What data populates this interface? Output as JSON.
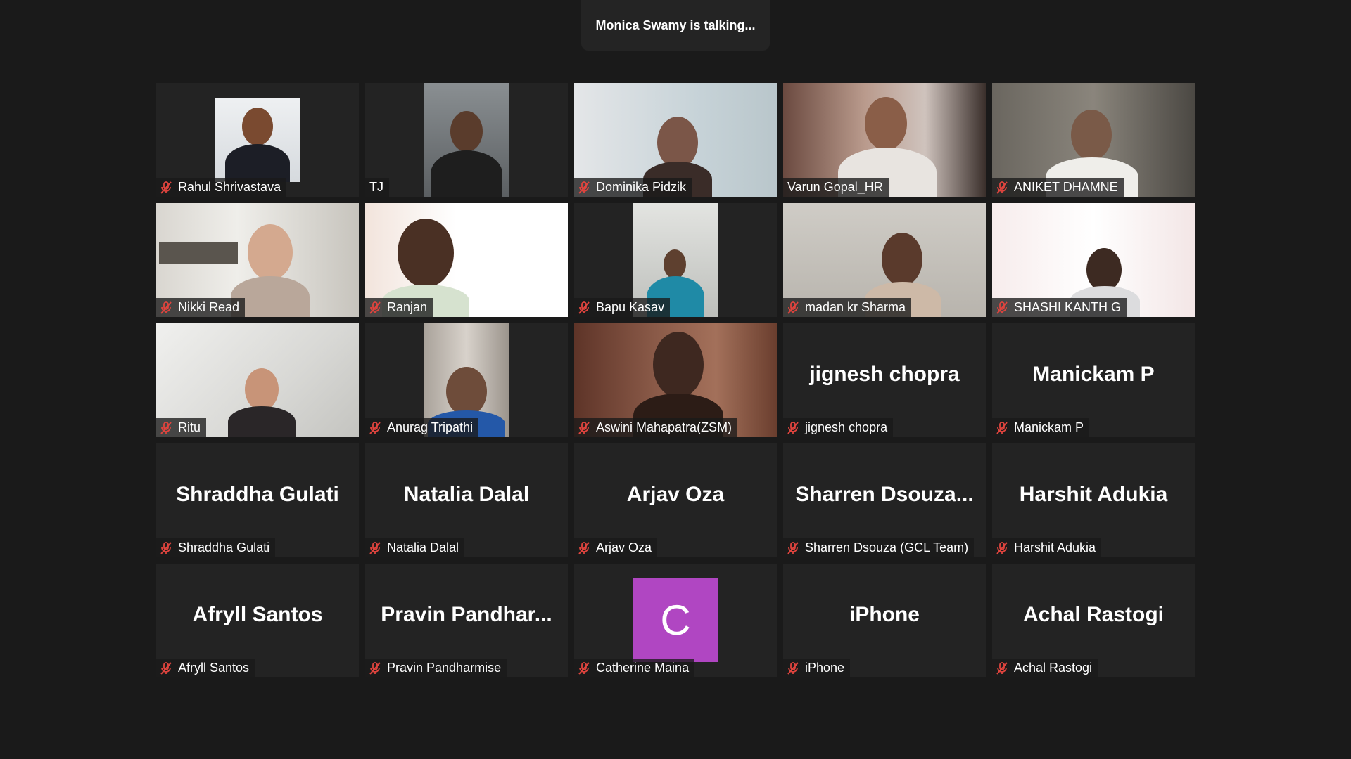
{
  "banner": {
    "text": "Monica Swamy is talking..."
  },
  "colors": {
    "background": "#1a1a1a",
    "tile": "#232323",
    "muted_icon": "#e0443e",
    "avatar_c": "#b046c2"
  },
  "participants": [
    {
      "name": "Rahul Shrivastava",
      "muted": true
    },
    {
      "name": "TJ",
      "muted": false
    },
    {
      "name": "Dominika Pidzik",
      "muted": true
    },
    {
      "name": "Varun Gopal_HR",
      "muted": false
    },
    {
      "name": "ANIKET DHAMNE",
      "muted": true
    },
    {
      "name": "Nikki Read",
      "muted": true
    },
    {
      "name": "Ranjan",
      "muted": true
    },
    {
      "name": "Bapu Kasav",
      "muted": true
    },
    {
      "name": "madan kr Sharma",
      "muted": true
    },
    {
      "name": "SHASHI KANTH G",
      "muted": true
    },
    {
      "name": "Ritu",
      "muted": true
    },
    {
      "name": "Anurag Tripathi",
      "muted": true
    },
    {
      "name": "Aswini Mahapatra(ZSM)",
      "muted": true
    },
    {
      "name": "jignesh chopra",
      "display": "jignesh chopra",
      "muted": true
    },
    {
      "name": "Manickam P",
      "display": "Manickam P",
      "muted": true
    },
    {
      "name": "Shraddha Gulati",
      "display": "Shraddha Gulati",
      "muted": true
    },
    {
      "name": "Natalia Dalal",
      "display": "Natalia Dalal",
      "muted": true
    },
    {
      "name": "Arjav Oza",
      "display": "Arjav Oza",
      "muted": true
    },
    {
      "name": "Sharren Dsouza (GCL Team)",
      "display": "Sharren  Dsouza...",
      "muted": true
    },
    {
      "name": "Harshit Adukia",
      "display": "Harshit Adukia",
      "muted": true
    },
    {
      "name": "Afryll Santos",
      "display": "Afryll Santos",
      "muted": true
    },
    {
      "name": "Pravin Pandharmise",
      "display": "Pravin  Pandhar...",
      "muted": true
    },
    {
      "name": "Catherine Maina",
      "avatar_letter": "C",
      "muted": true
    },
    {
      "name": "iPhone",
      "display": "iPhone",
      "muted": true
    },
    {
      "name": "Achal Rastogi",
      "display": "Achal Rastogi",
      "muted": true
    }
  ]
}
